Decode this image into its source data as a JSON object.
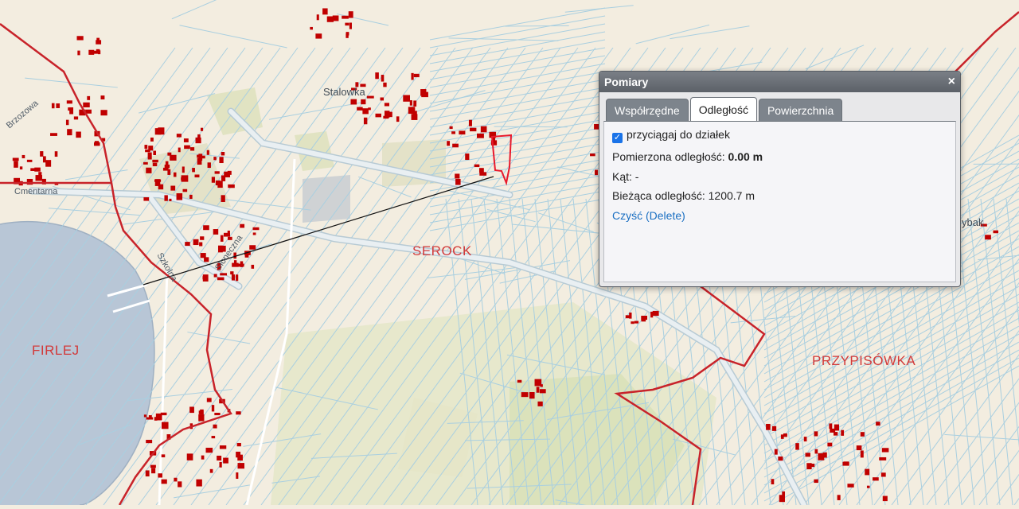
{
  "map": {
    "labels": {
      "cmentarna": "Cmentarna",
      "brzozowa": "Brzozowa",
      "stalowka": "Stalowka",
      "sloneczna": "Słoneczna",
      "szkolna": "Szkolna",
      "serock": "SEROCK",
      "firlej": "FIRLEJ",
      "przypisowka": "PRZYPISÓWKA",
      "rybak": "ybak"
    },
    "colors": {
      "background": "#f3ede0",
      "boundary": "#c8232a",
      "buildings": "#c00000",
      "parcels": "#a9cfe0",
      "water": "#b8c6d6",
      "field": "#e3e6c6",
      "road": "#dfe7ec"
    }
  },
  "dialog": {
    "title": "Pomiary",
    "close_icon": "×",
    "tabs": [
      "Współrzędne",
      "Odległość",
      "Powierzchnia"
    ],
    "active_tab": 1,
    "snap_label": "przyciągaj do działek",
    "snap_checked": true,
    "check_glyph": "✓",
    "measured_label": "Pomierzona odległość:",
    "measured_value": "0.00 m",
    "angle_text": "Kąt: -",
    "current_text": "Bieżąca odległość: 1200.7 m",
    "clear_link": "Czyść (Delete)"
  }
}
